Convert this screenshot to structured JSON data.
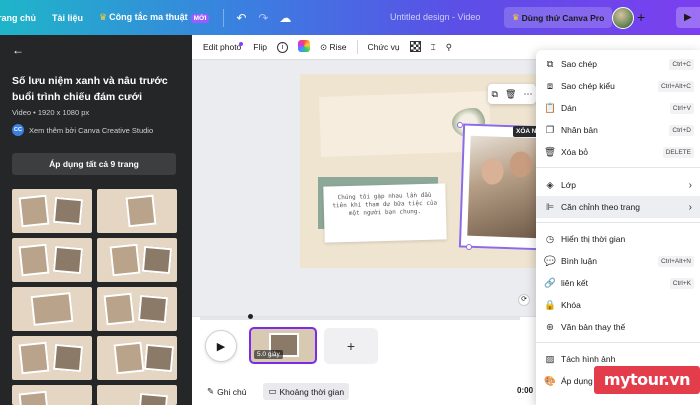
{
  "topbar": {
    "nav_home": "rang chủ",
    "nav_docs": "Tài liệu",
    "nav_magic": "Công tắc ma thuật",
    "badge_new": "MỚI",
    "doc_title": "Untitled design - Video",
    "try_pro": "Dùng thử Canva Pro"
  },
  "left_panel": {
    "title": "Số lưu niệm xanh và nâu trước buổi trình chiếu đám cưới",
    "meta": "Video • 1920 x 1080 px",
    "author_badge": "CC",
    "author": "Xem thêm bởi Canva Creative Studio",
    "apply_all": "Áp dụng tất cả 9 trang"
  },
  "toolbar": {
    "edit_photo": "Edit photo",
    "flip": "Flip",
    "rise": "Rise",
    "position": "Chức vụ"
  },
  "canvas": {
    "note_text": "Chúng tôi gặp nhau lần đầu tiên khi tham dự bữa tiệc của một người bạn chung.",
    "delete_tag": "XÓA N"
  },
  "timeline": {
    "clip_duration": "5.0 giây"
  },
  "footer": {
    "notes": "Ghi chú",
    "duration": "Khoảng thời gian",
    "time": "0:00"
  },
  "context_menu": {
    "items": [
      {
        "icon": "copy-icon",
        "label": "Sao chép",
        "shortcut": "Ctrl+C"
      },
      {
        "icon": "copy-style-icon",
        "label": "Sao chép kiểu",
        "shortcut": "Ctrl+Alt+C"
      },
      {
        "icon": "paste-icon",
        "label": "Dán",
        "shortcut": "Ctrl+V"
      },
      {
        "icon": "duplicate-icon",
        "label": "Nhân bản",
        "shortcut": "Ctrl+D"
      },
      {
        "icon": "trash-icon",
        "label": "Xóa bỏ",
        "shortcut": "DELETE"
      },
      {
        "icon": "layers-icon",
        "label": "Lớp"
      },
      {
        "icon": "align-icon",
        "label": "Căn chỉnh theo trang"
      },
      {
        "icon": "clock-icon",
        "label": "Hiển thị thời gian"
      },
      {
        "icon": "comment-icon",
        "label": "Bình luận",
        "shortcut": "Ctrl+Alt+N"
      },
      {
        "icon": "link-icon",
        "label": "liên kết",
        "shortcut": "Ctrl+K"
      },
      {
        "icon": "lock-icon",
        "label": "Khóa"
      },
      {
        "icon": "accessibility-icon",
        "label": "Văn bản thay thế"
      },
      {
        "icon": "detach-image-icon",
        "label": "Tách hình ảnh"
      },
      {
        "icon": "palette-icon",
        "label": "Áp dụng"
      }
    ]
  },
  "watermark": "mytour.vn",
  "colors": {
    "accent": "#7d2ae8",
    "topbar_start": "#1fb5c9",
    "topbar_end": "#7b3ff0",
    "panel_bg": "#252627"
  }
}
